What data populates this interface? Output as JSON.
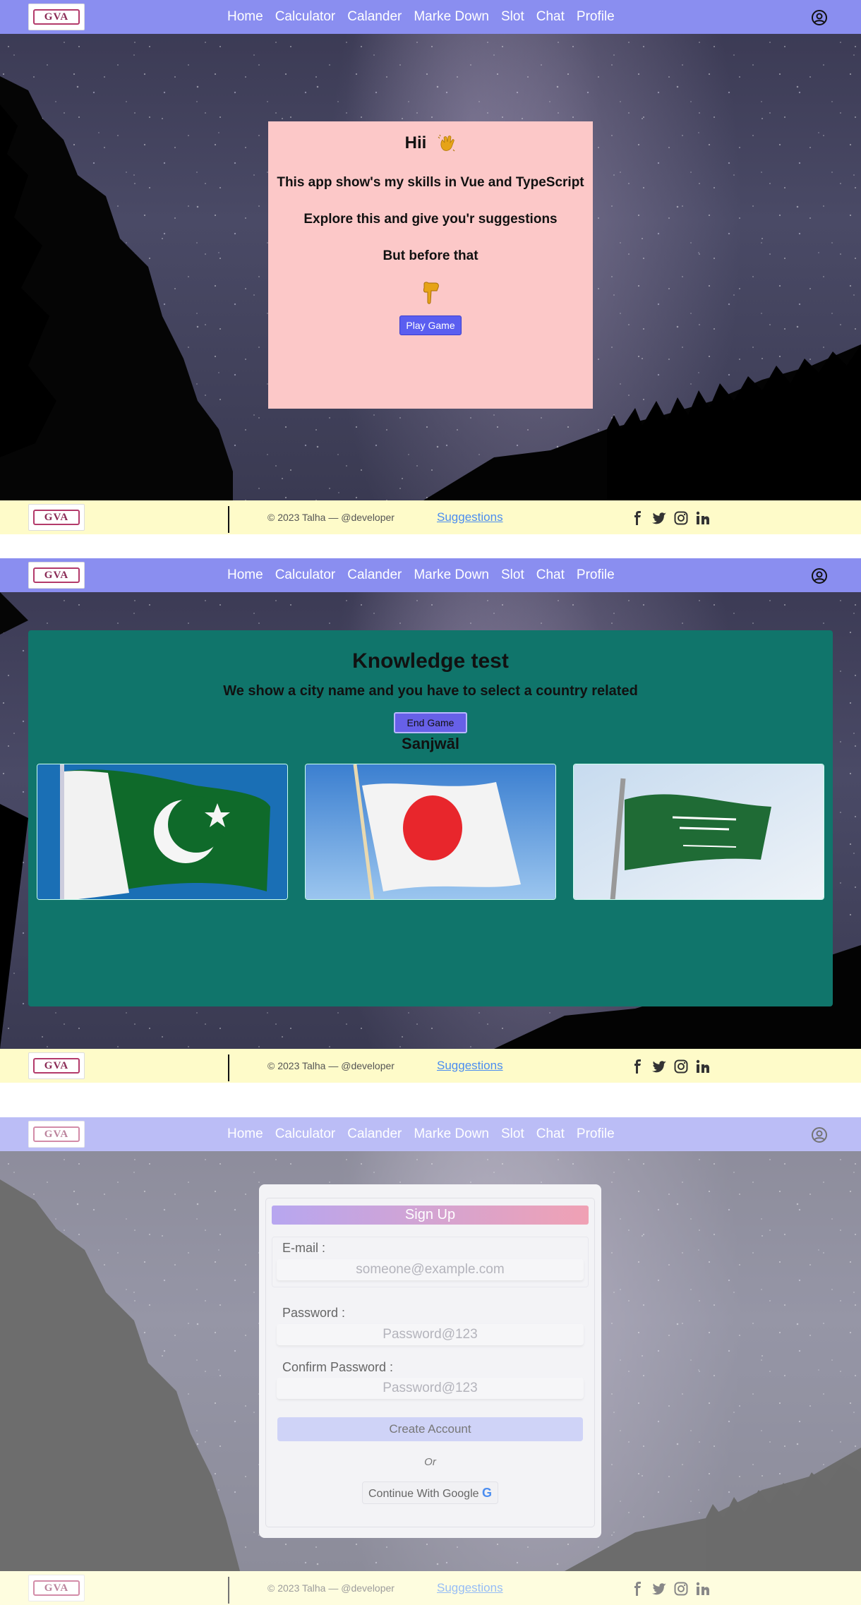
{
  "nav": {
    "logo_text": "GVA",
    "links": [
      "Home",
      "Calculator",
      "Calander",
      "Marke Down",
      "Slot",
      "Chat",
      "Profile"
    ]
  },
  "footer": {
    "copyright": "© 2023 Talha —",
    "handle": "@developer",
    "suggestions": "Suggestions",
    "social_icons": [
      "facebook-icon",
      "twitter-icon",
      "instagram-icon",
      "linkedin-icon"
    ]
  },
  "welcome": {
    "greeting": "Hii",
    "line1": "This app show's my skills in Vue and TypeScript",
    "line2": "Explore this and give you'r suggestions",
    "line3": "But before that",
    "play_button": "Play Game"
  },
  "quiz": {
    "title": "Knowledge test",
    "subtitle": "We show a city name and you have to select a country related",
    "end_button": "End Game",
    "city": "Sanjwāl",
    "flag_options": [
      "pakistan-flag",
      "japan-flag",
      "saudi-arabia-flag"
    ]
  },
  "signup": {
    "title": "Sign Up",
    "email_label": "E-mail :",
    "email_placeholder": "someone@example.com",
    "password_label": "Password :",
    "password_placeholder": "Password@123",
    "confirm_label": "Confirm Password :",
    "confirm_placeholder": "Password@123",
    "create_button": "Create Account",
    "or_text": "Or",
    "google_button": "Continue With Google",
    "google_glyph": "G"
  },
  "colors": {
    "navbar": "#8a8ef0",
    "footer": "#fefbc9",
    "welcome_card": "#fcc8c8",
    "quiz_card": "#10756b",
    "accent_button": "#5a5ef0",
    "link": "#4b8df0"
  }
}
